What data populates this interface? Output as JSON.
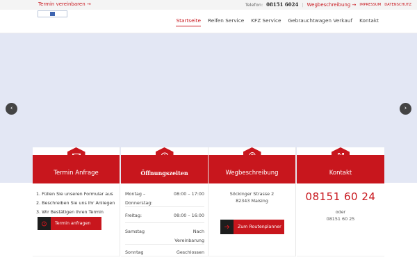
{
  "topbar": {
    "appointment_link": "Termin vereinbaren →",
    "phone_label": "Telefon:",
    "phone_number": "08151 6024",
    "separator": "|",
    "route_link": "Wegbeschreibung →",
    "imprint_link": "IMPRESSUM",
    "privacy_link": "DATENSCHUTZ"
  },
  "nav": {
    "items": [
      "Startseite",
      "Reifen Service",
      "KFZ Service",
      "Gebrauchtwagen Verkauf",
      "Kontakt"
    ],
    "active_index": 0
  },
  "slider": {
    "prev_icon": "chevron-left-icon",
    "next_icon": "chevron-right-icon"
  },
  "cards": {
    "appointment": {
      "title": "Termin Anfrage",
      "icon": "envelope-icon",
      "steps": [
        "1.  Füllen Sie unseren Formular aus",
        "2.  Beschreiben Sie uns Ihr Anliegen",
        "3.  Wir Bestätigen Ihren Termin"
      ],
      "button_label": "Termin anfragen",
      "button_icon": "alarm-clock-icon"
    },
    "hours": {
      "title": "Öffnungszeiten",
      "icon": "clock-icon",
      "rows": [
        {
          "day": "Montag – Donnerstag:",
          "time": "08:00 – 17:00"
        },
        {
          "day": "Freitag:",
          "time": "08:00 – 16:00"
        },
        {
          "day": "Samstag",
          "time": "Nach Vereinbarung"
        },
        {
          "day": "Sonntag",
          "time": "Geschlossen"
        }
      ]
    },
    "route": {
      "title": "Wegbeschreibung",
      "icon": "map-pin-icon",
      "street": "Söckinger Strasse 2",
      "city": "82343 Maising",
      "button_label": "Zum Routenplanner",
      "button_icon": "arrow-right-icon"
    },
    "contact": {
      "title": "Kontakt",
      "icon": "phone-icon",
      "phone_big": "08151 60 24",
      "or_label": "oder",
      "phone_alt": "08151 60 25"
    }
  },
  "colors": {
    "accent": "#c8161d",
    "dark": "#1d1d1d",
    "slider_bg": "#e3e7f4"
  }
}
